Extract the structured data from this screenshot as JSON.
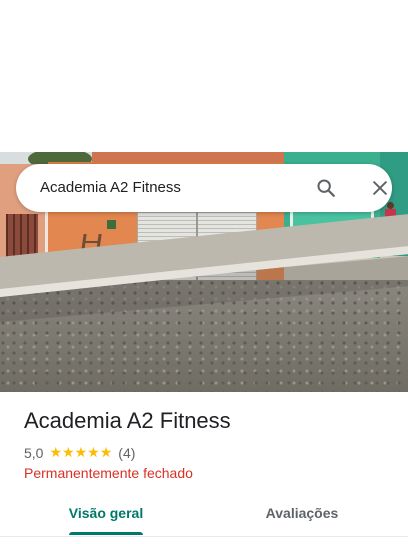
{
  "search": {
    "query": "Academia A2 Fitness",
    "search_icon": "search-icon",
    "close_icon": "close-icon"
  },
  "photo": {
    "description_icon": "street-photo"
  },
  "place": {
    "name": "Academia A2 Fitness",
    "rating_value": "5,0",
    "rating": 5,
    "rating_max": 5,
    "review_count": "(4)",
    "status": "Permanentemente fechado"
  },
  "tabs": [
    {
      "label": "Visão geral",
      "selected": true
    },
    {
      "label": "Avaliações",
      "selected": false
    }
  ],
  "colors": {
    "accent": "#00796b",
    "star": "#fbbc04",
    "status_closed": "#d93025",
    "text_primary": "#202124",
    "text_secondary": "#5f6368"
  }
}
